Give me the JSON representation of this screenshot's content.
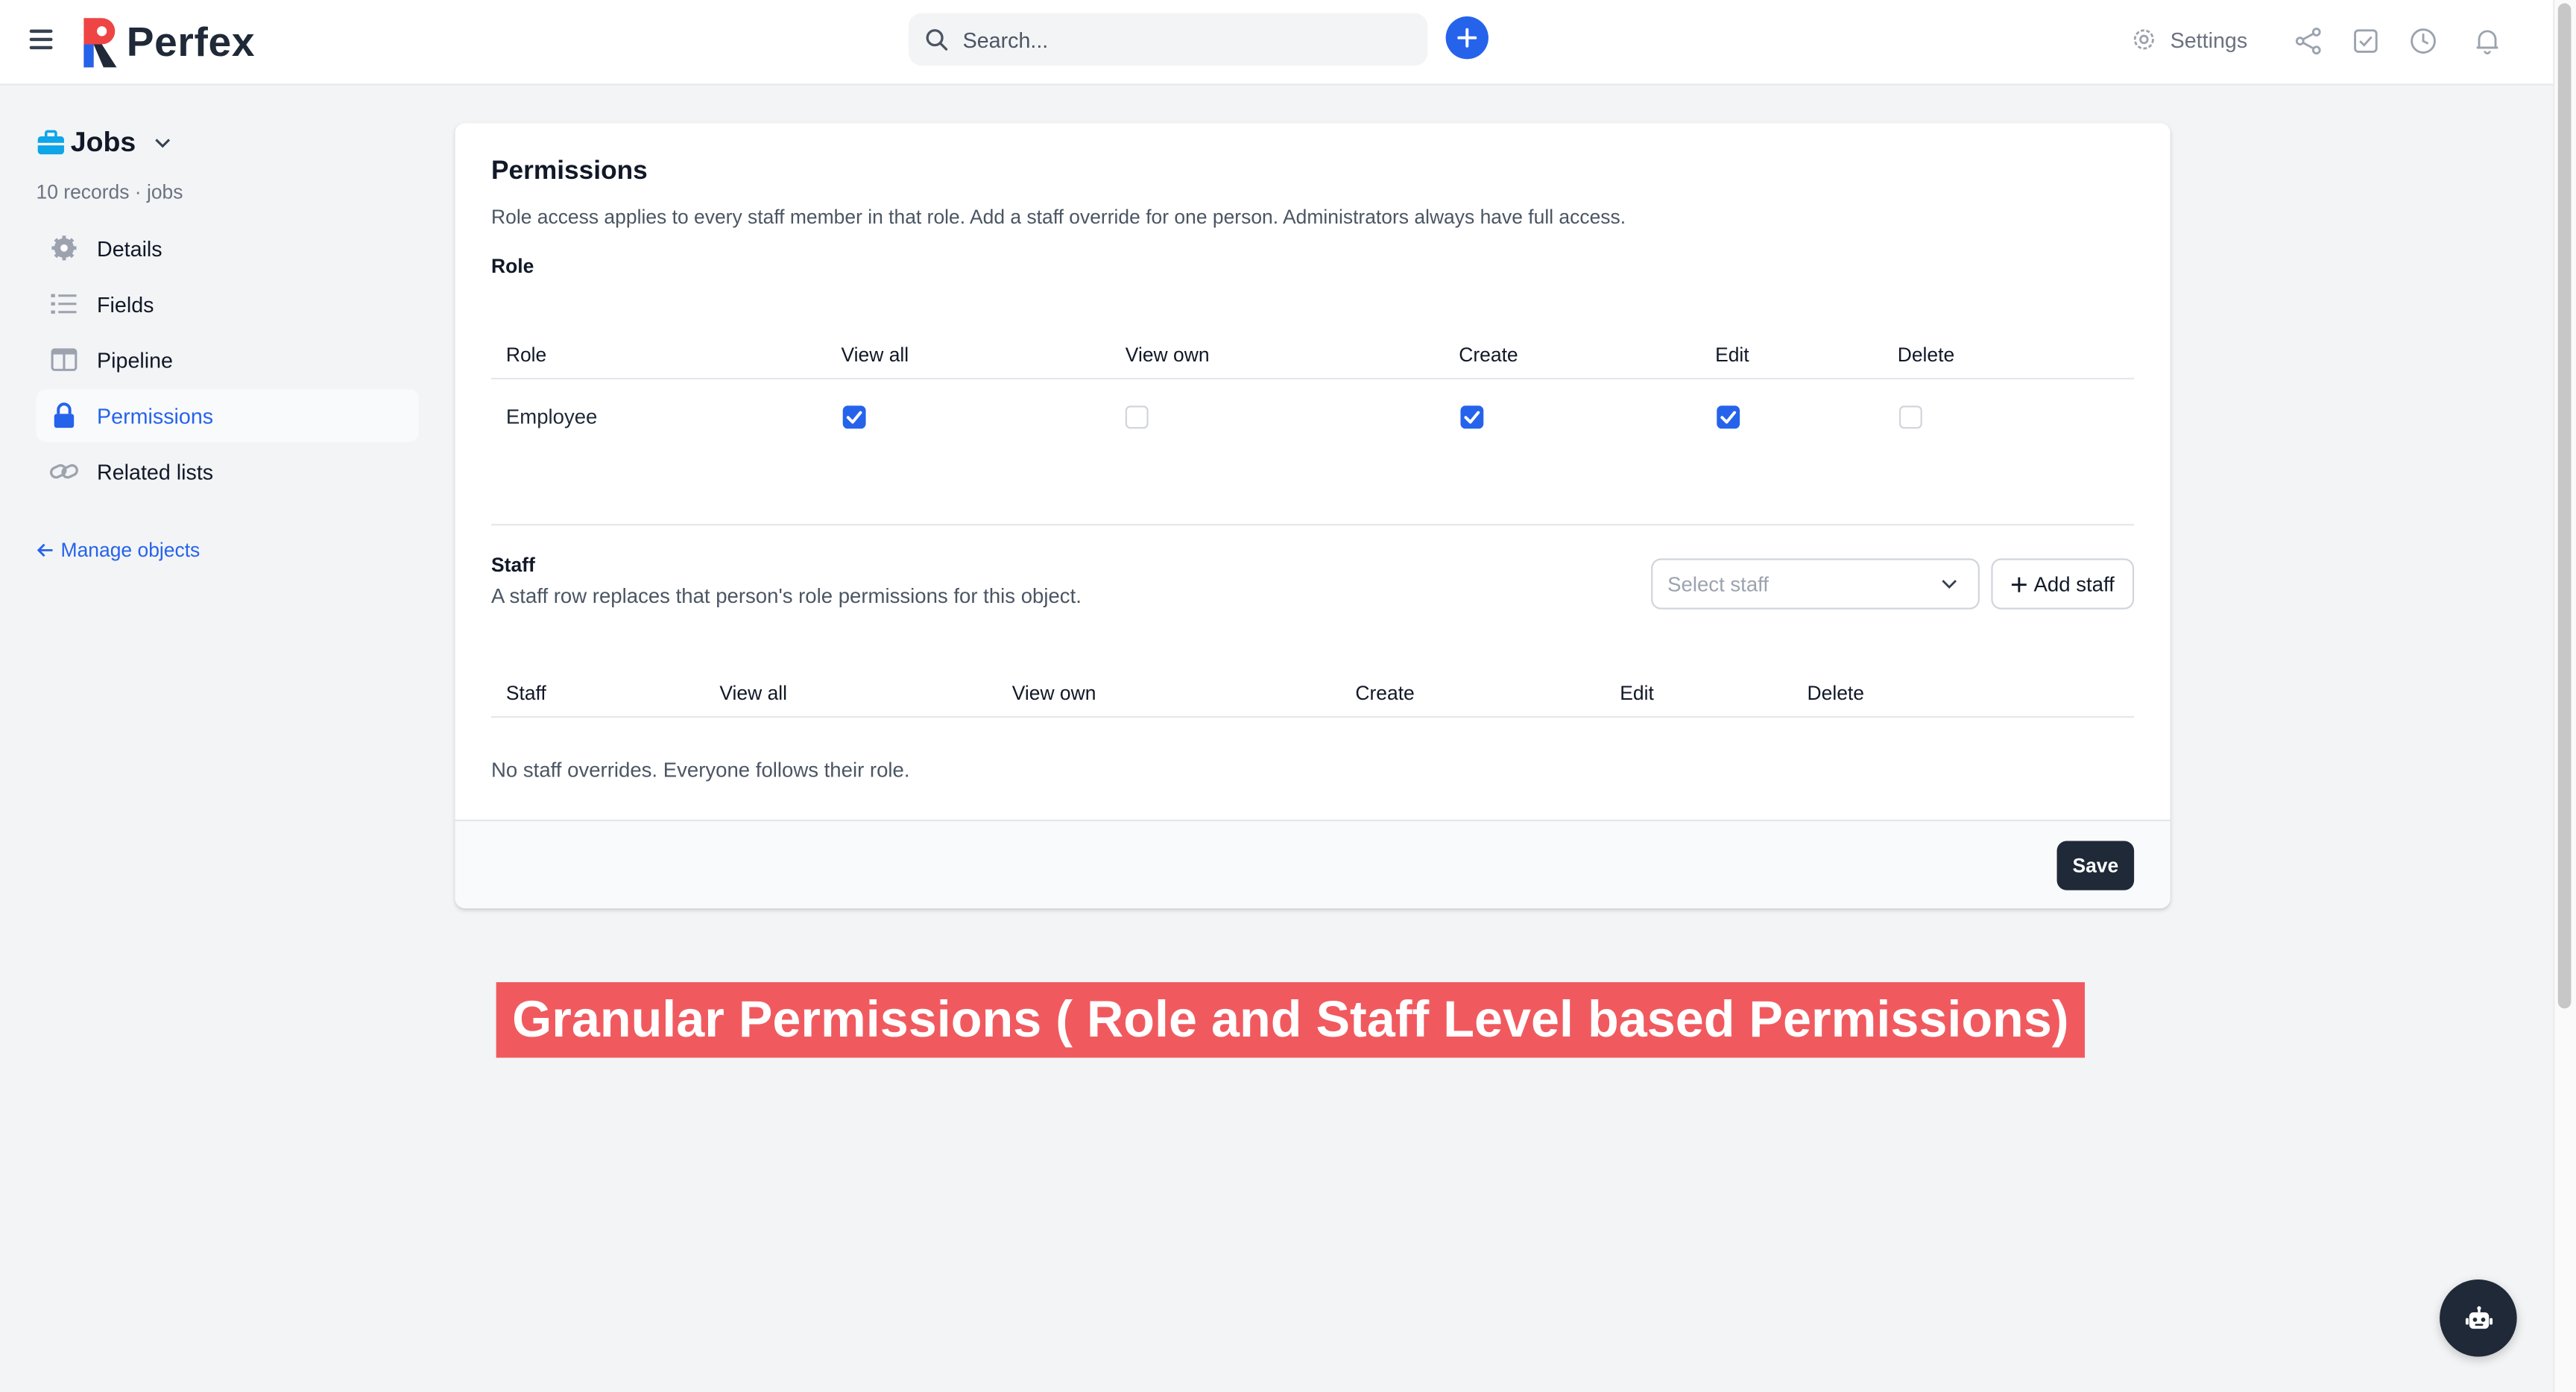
{
  "app": {
    "name": "Perfex"
  },
  "search": {
    "placeholder": "Search..."
  },
  "header": {
    "settings_label": "Settings"
  },
  "object": {
    "title": "Jobs",
    "subtitle": "10 records · jobs"
  },
  "sidebar": {
    "items": [
      {
        "label": "Details",
        "icon": "gear-icon"
      },
      {
        "label": "Fields",
        "icon": "list-icon"
      },
      {
        "label": "Pipeline",
        "icon": "columns-icon"
      },
      {
        "label": "Permissions",
        "icon": "lock-icon",
        "active": true
      },
      {
        "label": "Related lists",
        "icon": "link-icon"
      }
    ],
    "manage_link": "Manage objects"
  },
  "permissions": {
    "title": "Permissions",
    "description": "Role access applies to every staff member in that role. Add a staff override for one person. Administrators always have full access.",
    "role_section_label": "Role",
    "role_columns": [
      "Role",
      "View all",
      "View own",
      "Create",
      "Edit",
      "Delete"
    ],
    "role_rows": [
      {
        "name": "Employee",
        "view_all": true,
        "view_own": false,
        "create": true,
        "edit": true,
        "delete": false
      }
    ],
    "staff_section_label": "Staff",
    "staff_description": "A staff row replaces that person's role permissions for this object.",
    "select_placeholder": "Select staff",
    "add_staff_label": "Add staff",
    "staff_columns": [
      "Staff",
      "View all",
      "View own",
      "Create",
      "Edit",
      "Delete"
    ],
    "empty_text": "No staff overrides. Everyone follows their role.",
    "save_label": "Save"
  },
  "banner": {
    "text": "Granular Permissions ( Role and Staff Level based Permissions)"
  },
  "colors": {
    "accent": "#2563eb",
    "banner": "#f05a5f",
    "dark": "#1f2937"
  }
}
